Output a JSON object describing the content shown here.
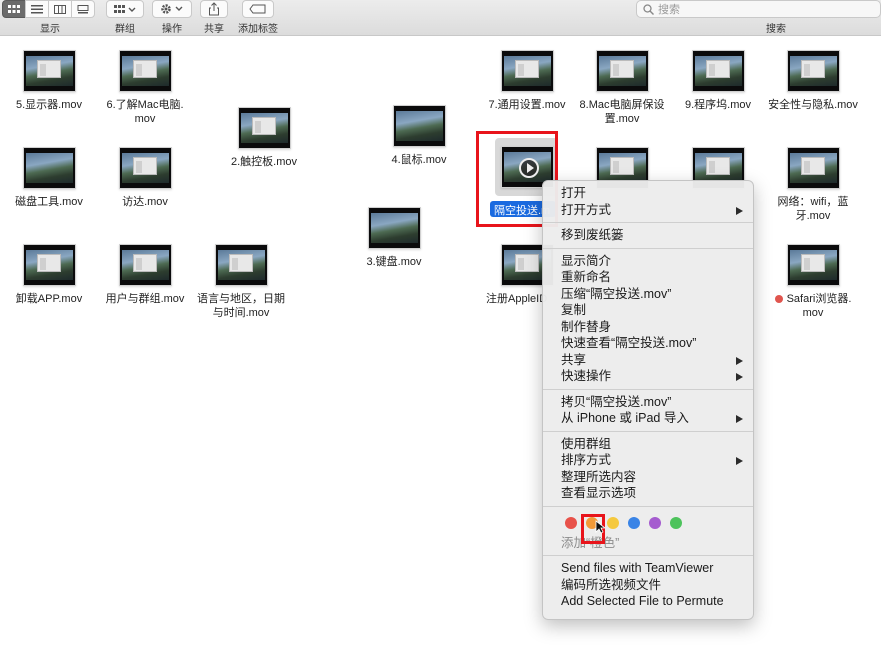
{
  "toolbar": {
    "view_label": "显示",
    "group_label": "群组",
    "action_label": "操作",
    "share_label": "共享",
    "tags_label": "添加标签",
    "search_label": "搜索",
    "search_placeholder": "搜索"
  },
  "files": [
    {
      "name": "5.显示器.mov"
    },
    {
      "name": "6.了解Mac电脑.mov"
    },
    {
      "name": "2.触控板.mov"
    },
    {
      "name": "4.鼠标.mov"
    },
    {
      "name": "7.通用设置.mov"
    },
    {
      "name": "8.Mac电脑屏保设置.mov"
    },
    {
      "name": "9.程序坞.mov"
    },
    {
      "name": "安全性与隐私.mov"
    },
    {
      "name": "磁盘工具.mov"
    },
    {
      "name": "访达.mov"
    },
    {
      "name": "3.键盘.mov"
    },
    {
      "name": "网络：wifi，蓝牙.mov"
    },
    {
      "name": "卸载APP.mov"
    },
    {
      "name": "用户与群组.mov"
    },
    {
      "name": "语言与地区，日期与时间.mov"
    },
    {
      "name": "注册AppleID"
    },
    {
      "name": "Safari浏览器.mov"
    }
  ],
  "selected_file": {
    "name": "隔空投送.mov",
    "label_shown": "隔空投送.m"
  },
  "context_menu": {
    "open": "打开",
    "open_with": "打开方式",
    "move_to_trash": "移到废纸篓",
    "get_info": "显示简介",
    "rename": "重新命名",
    "compress": "压缩“隔空投送.mov”",
    "duplicate": "复制",
    "make_alias": "制作替身",
    "quick_look": "快速查看“隔空投送.mov”",
    "share": "共享",
    "quick_actions": "快速操作",
    "copy": "拷贝“隔空投送.mov”",
    "import_iphone": "从 iPhone 或 iPad 导入",
    "use_groups": "使用群组",
    "sort_by": "排序方式",
    "clean_up": "整理所选内容",
    "view_options": "查看显示选项",
    "tag_hint": "添加“橙色”",
    "teamviewer": "Send files with TeamViewer",
    "encode": "编码所选视频文件",
    "permute": "Add Selected File to Permute"
  },
  "tag_colors": [
    "#e8524a",
    "#f29a38",
    "#f5c93e",
    "#3a84e6",
    "#a55ccf",
    "#4dc35c"
  ]
}
